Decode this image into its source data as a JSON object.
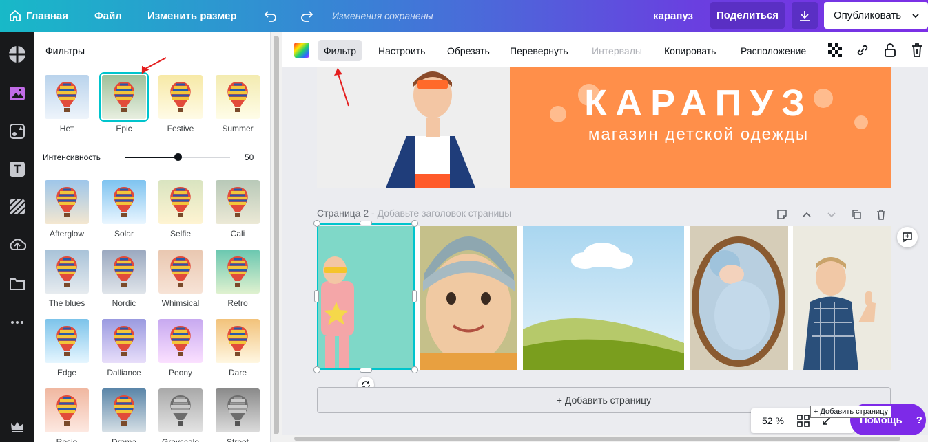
{
  "topbar": {
    "home_label": "Главная",
    "file_label": "Файл",
    "resize_label": "Изменить размер",
    "saved_status": "Изменения сохранены",
    "design_title": "карапуз",
    "share_label": "Поделиться",
    "publish_label": "Опубликовать"
  },
  "panel": {
    "title": "Фильтры",
    "intensity_label": "Интенсивность",
    "intensity_value": "50",
    "intensity_level": 0.5,
    "filters": [
      {
        "label": "Нет"
      },
      {
        "label": "Epic"
      },
      {
        "label": "Festive"
      },
      {
        "label": "Summer"
      },
      {
        "label": "Afterglow"
      },
      {
        "label": "Solar"
      },
      {
        "label": "Selfie"
      },
      {
        "label": "Cali"
      },
      {
        "label": "The blues"
      },
      {
        "label": "Nordic"
      },
      {
        "label": "Whimsical"
      },
      {
        "label": "Retro"
      },
      {
        "label": "Edge"
      },
      {
        "label": "Dalliance"
      },
      {
        "label": "Peony"
      },
      {
        "label": "Dare"
      },
      {
        "label": "Rosie"
      },
      {
        "label": "Drama"
      },
      {
        "label": "Grayscale"
      },
      {
        "label": "Street"
      }
    ],
    "selected_filter": "Epic"
  },
  "toolbar": {
    "filter_label": "Фильтр",
    "adjust_label": "Настроить",
    "crop_label": "Обрезать",
    "flip_label": "Перевернуть",
    "spacing_label": "Интервалы",
    "copy_label": "Копировать",
    "position_label": "Расположение"
  },
  "canvas": {
    "banner_title": "КАРАПУЗ",
    "banner_subtitle": "магазин детской одежды",
    "page2_label": "Страница 2 - ",
    "page2_placeholder": "Добавьте заголовок страницы",
    "add_page_label": "+ Добавить страницу"
  },
  "footer": {
    "zoom": "52 %",
    "help_label": "Помощь",
    "help_q": "?",
    "tooltip": "+ Добавить страницу"
  },
  "colors": {
    "accent": "#00c4cc",
    "brand_purple": "#7d2ae8",
    "banner_orange": "#ff8f4a"
  }
}
